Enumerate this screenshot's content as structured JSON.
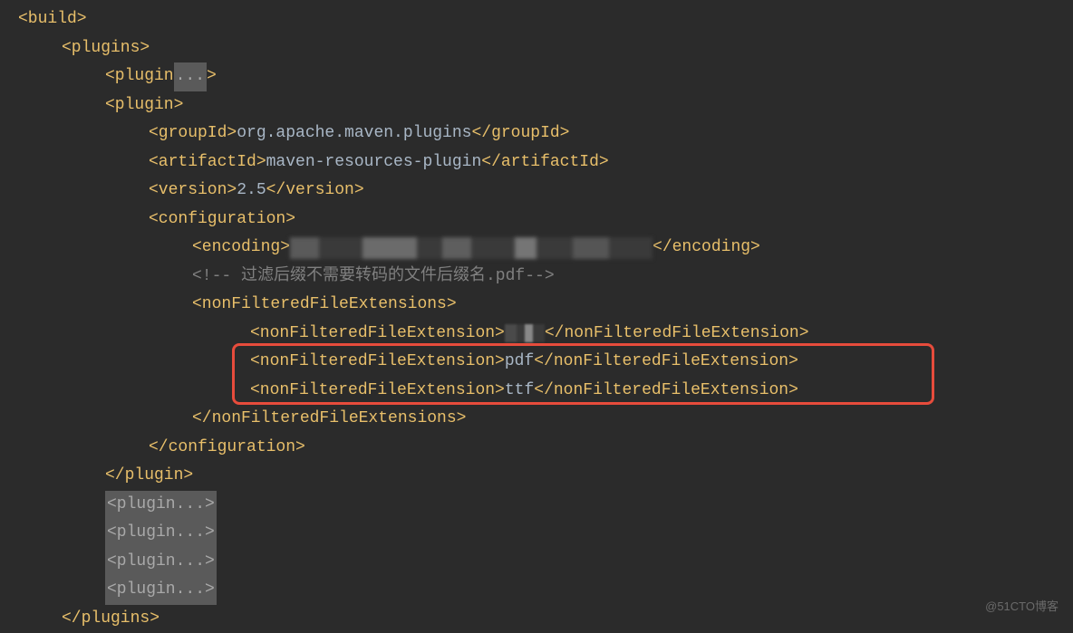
{
  "xml": {
    "build_open": "<build>",
    "plugins_open": "<plugins>",
    "plugin_open": "<plugin",
    "plugin_close_b": ">",
    "plugin_full_open": "<plugin>",
    "fold": "...",
    "groupId_open": "<groupId>",
    "groupId_val": "org.apache.maven.plugins",
    "groupId_close": "</groupId>",
    "artifactId_open": "<artifactId>",
    "artifactId_val": "maven-resources-plugin",
    "artifactId_close": "</artifactId>",
    "version_open": "<version>",
    "version_val": "2.5",
    "version_close": "</version>",
    "configuration_open": "<configuration>",
    "encoding_open": "<encoding>",
    "encoding_close": "</encoding>",
    "comment": "<!-- 过滤后缀不需要转码的文件后缀名.pdf-->",
    "nffe_open": "<nonFilteredFileExtensions>",
    "nff_open": "<nonFilteredFileExtension>",
    "nff_close": "</nonFilteredFileExtension>",
    "nff_val_pdf": "pdf",
    "nff_val_ttf": "ttf",
    "nffe_close": "</nonFilteredFileExtensions>",
    "configuration_close": "</configuration>",
    "plugin_close": "</plugin>",
    "plugins_close": "</plugins>"
  },
  "watermark": "@51CTO博客"
}
